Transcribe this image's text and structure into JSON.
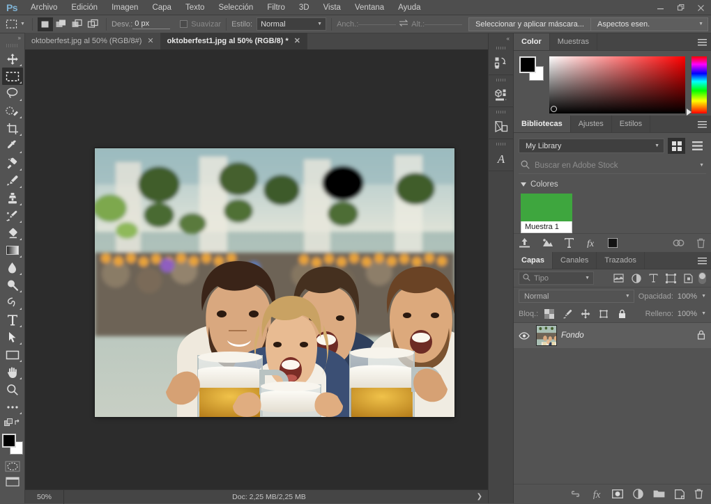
{
  "app": {
    "logo": "Ps",
    "title": "Adobe Photoshop"
  },
  "menubar": {
    "items": [
      {
        "label": "Archivo"
      },
      {
        "label": "Edición"
      },
      {
        "label": "Imagen"
      },
      {
        "label": "Capa"
      },
      {
        "label": "Texto"
      },
      {
        "label": "Selección"
      },
      {
        "label": "Filtro"
      },
      {
        "label": "3D"
      },
      {
        "label": "Vista"
      },
      {
        "label": "Ventana"
      },
      {
        "label": "Ayuda"
      }
    ]
  },
  "window_controls": {
    "minimize": "–",
    "restore": "❐",
    "close": "✕"
  },
  "options_bar": {
    "tool_preset_icon": "rectangular-marquee-icon",
    "mode_buttons": [
      {
        "name": "new-selection",
        "active": true
      },
      {
        "name": "add-to-selection",
        "active": false
      },
      {
        "name": "subtract-from-selection",
        "active": false
      },
      {
        "name": "intersect-with-selection",
        "active": false
      }
    ],
    "feather_label": "Desv.:",
    "feather_value": "0 px",
    "antialias_label": "Suavizar",
    "antialias_checked": false,
    "style_label": "Estilo:",
    "style_value": "Normal",
    "width_label": "Anch.:",
    "width_value": "",
    "height_label": "Alt.:",
    "height_value": "",
    "select_and_mask": "Seleccionar y aplicar máscara...",
    "workspace": "Aspectos esen."
  },
  "toolbar": {
    "expand_label": "»",
    "tools": [
      {
        "name": "move-tool",
        "label": "Mover",
        "active": false
      },
      {
        "name": "rectangular-marquee-tool",
        "label": "Marco rectangular",
        "active": true
      },
      {
        "name": "lasso-tool",
        "label": "Lazo",
        "active": false
      },
      {
        "name": "quick-selection-tool",
        "label": "Selección rápida",
        "active": false
      },
      {
        "name": "crop-tool",
        "label": "Recortar",
        "active": false
      },
      {
        "name": "eyedropper-tool",
        "label": "Cuentagotas",
        "active": false
      },
      {
        "name": "healing-brush-tool",
        "label": "Pincel corrector",
        "active": false
      },
      {
        "name": "brush-tool",
        "label": "Pincel",
        "active": false
      },
      {
        "name": "clone-stamp-tool",
        "label": "Tampón de clonar",
        "active": false
      },
      {
        "name": "history-brush-tool",
        "label": "Pincel de historia",
        "active": false
      },
      {
        "name": "eraser-tool",
        "label": "Borrador",
        "active": false
      },
      {
        "name": "gradient-tool",
        "label": "Degradado",
        "active": false
      },
      {
        "name": "blur-tool",
        "label": "Desenfocar",
        "active": false
      },
      {
        "name": "dodge-tool",
        "label": "Sobreexponer",
        "active": false
      },
      {
        "name": "pen-tool",
        "label": "Pluma",
        "active": false
      },
      {
        "name": "type-tool",
        "label": "Texto",
        "active": false
      },
      {
        "name": "path-selection-tool",
        "label": "Selección de trazado",
        "active": false
      },
      {
        "name": "rectangle-tool",
        "label": "Rectángulo",
        "active": false
      },
      {
        "name": "hand-tool",
        "label": "Mano",
        "active": false
      },
      {
        "name": "zoom-tool",
        "label": "Zoom",
        "active": false
      },
      {
        "name": "edit-toolbar-tool",
        "label": "Editar barra de herramientas",
        "active": false
      }
    ],
    "foreground_color": "#000000",
    "background_color": "#ffffff",
    "quick_mask_label": "Modo de máscara rápida"
  },
  "tabs": {
    "documents": [
      {
        "title": "oktoberfest.jpg al 50% (RGB/8#)",
        "active": false,
        "close": "✕"
      },
      {
        "title": "oktoberfest1.jpg al 50% (RGB/8) *",
        "active": true,
        "close": "✕"
      }
    ]
  },
  "canvas": {
    "image_alt": "Cuatro personas brindando con jarras de cerveza en el Oktoberfest",
    "zoom": "50%"
  },
  "status_bar": {
    "zoom": "50%",
    "doc_info": "Doc: 2,25 MB/2,25 MB",
    "arrow": "❯"
  },
  "dock": {
    "collapse_label": "«",
    "icons": [
      {
        "name": "history-panel-icon",
        "label": "Historia"
      },
      {
        "name": "3d-panel-icon",
        "label": "3D"
      },
      {
        "name": "properties-panel-icon",
        "label": "Propiedades"
      },
      {
        "name": "character-panel-icon",
        "label": "Carácter"
      }
    ]
  },
  "color_panel": {
    "tabs": [
      {
        "label": "Color",
        "active": true
      },
      {
        "label": "Muestras",
        "active": false
      }
    ],
    "foreground": "#000000",
    "background": "#ffffff"
  },
  "libraries_panel": {
    "tabs": [
      {
        "label": "Bibliotecas",
        "active": true
      },
      {
        "label": "Ajustes",
        "active": false
      },
      {
        "label": "Estilos",
        "active": false
      }
    ],
    "library_name": "My Library",
    "search_placeholder": "Buscar en Adobe Stock",
    "section_title": "Colores",
    "swatch": {
      "label": "Muestra 1",
      "color": "#3ea63e"
    },
    "view_grid_active": true,
    "footer_icons": [
      {
        "name": "upload-icon"
      },
      {
        "name": "add-graphic-icon"
      },
      {
        "name": "add-text-style-icon"
      },
      {
        "name": "add-layer-style-icon"
      },
      {
        "name": "add-color-icon"
      },
      {
        "name": "sync-icon"
      },
      {
        "name": "delete-icon"
      }
    ]
  },
  "layers_panel": {
    "tabs": [
      {
        "label": "Capas",
        "active": true
      },
      {
        "label": "Canales",
        "active": false
      },
      {
        "label": "Trazados",
        "active": false
      }
    ],
    "filter_placeholder": "Tipo",
    "filter_icons": [
      {
        "name": "filter-pixel-icon"
      },
      {
        "name": "filter-adjustment-icon"
      },
      {
        "name": "filter-type-icon"
      },
      {
        "name": "filter-shape-icon"
      },
      {
        "name": "filter-smartobject-icon"
      }
    ],
    "blend_mode": "Normal",
    "opacity_label": "Opacidad:",
    "opacity_value": "100%",
    "lock_label": "Bloq.:",
    "lock_icons": [
      {
        "name": "lock-transparent-pixels-icon"
      },
      {
        "name": "lock-image-pixels-icon"
      },
      {
        "name": "lock-position-icon"
      },
      {
        "name": "lock-artboard-icon"
      },
      {
        "name": "lock-all-icon"
      }
    ],
    "fill_label": "Relleno:",
    "fill_value": "100%",
    "layers": [
      {
        "name": "Fondo",
        "visible": true,
        "locked": true,
        "selected": true
      }
    ],
    "footer_icons": [
      {
        "name": "link-layers-icon"
      },
      {
        "name": "layer-style-fx-icon"
      },
      {
        "name": "add-layer-mask-icon"
      },
      {
        "name": "new-adjustment-layer-icon"
      },
      {
        "name": "new-group-icon"
      },
      {
        "name": "new-layer-icon"
      },
      {
        "name": "delete-layer-icon"
      }
    ]
  }
}
